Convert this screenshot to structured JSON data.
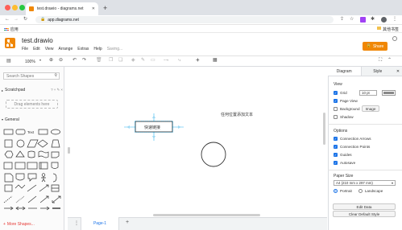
{
  "browser": {
    "tab_title": "test.drawio - diagrams.net",
    "new_tab": "+",
    "url": "app.diagrams.net",
    "bookmark_apps": "应用",
    "bookmark_other": "其他书签"
  },
  "app": {
    "file_name": "test.drawio",
    "share_label": "Share",
    "saving_status": "Saving...",
    "menu": [
      "File",
      "Edit",
      "View",
      "Arrange",
      "Extras",
      "Help"
    ],
    "zoom": "100%"
  },
  "shapes_panel": {
    "search_placeholder": "Search Shapes",
    "scratchpad_label": "Scratchpad",
    "scratchpad_tools": "? + ✎ ×",
    "drag_hint": "Drag elements here",
    "general_label": "General",
    "text_shape_label": "Text",
    "more_shapes": "More Shapes..."
  },
  "canvas": {
    "rect_label": "快速链接",
    "free_text": "任何位置添加文本"
  },
  "format_panel": {
    "tabs": [
      "Diagram",
      "Style"
    ],
    "view_header": "View",
    "grid_label": "Grid",
    "grid_size": "10 pt",
    "grid_color": "#888888",
    "page_view_label": "Page View",
    "background_label": "Background",
    "image_button": "Image",
    "shadow_label": "Shadow",
    "options_header": "Options",
    "connection_arrows": "Connection Arrows",
    "connection_points": "Connection Points",
    "guides": "Guides",
    "autosave": "Autosave",
    "paper_size_header": "Paper Size",
    "paper_size_value": "A4 (210 mm x 297 mm)",
    "portrait": "Portrait",
    "landscape": "Landscape",
    "edit_data": "Edit Data",
    "clear_default_style": "Clear Default Style"
  },
  "pages": {
    "page1": "Page-1",
    "add_page": "+"
  },
  "colors": {
    "accent": "#f08705",
    "checkbox": "#1a73e8",
    "selection": "#29b6f2"
  }
}
